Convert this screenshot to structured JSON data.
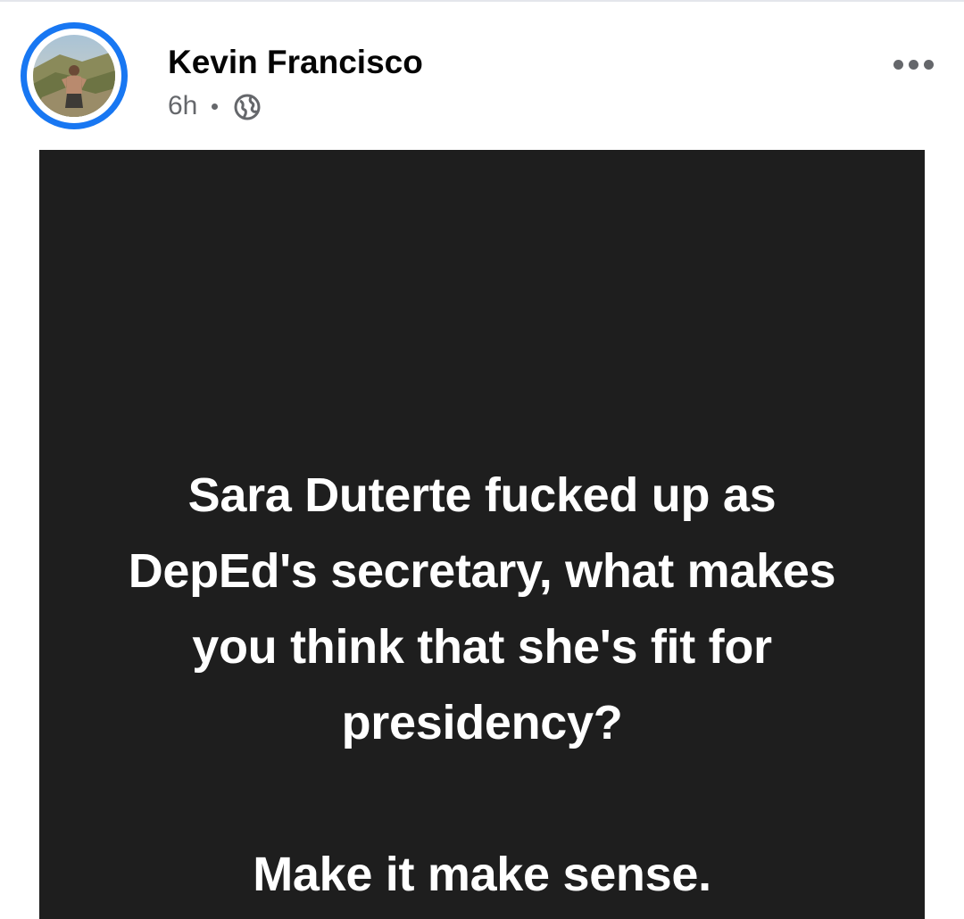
{
  "post": {
    "author": {
      "name": "Kevin Francisco",
      "avatar_icon": "profile-photo-icon",
      "story_ring_color": "#1877f2"
    },
    "meta": {
      "time": "6h",
      "privacy_icon": "globe-icon"
    },
    "menu": {
      "icon": "more-options-icon"
    },
    "card": {
      "background_color": "#1e1e1e",
      "text_color": "#ffffff",
      "lines": [
        "Sara Duterte fucked up as",
        "DepEd's secretary, what makes",
        "you think that she's fit for",
        "presidency?"
      ],
      "closing": "Make it make sense."
    }
  }
}
